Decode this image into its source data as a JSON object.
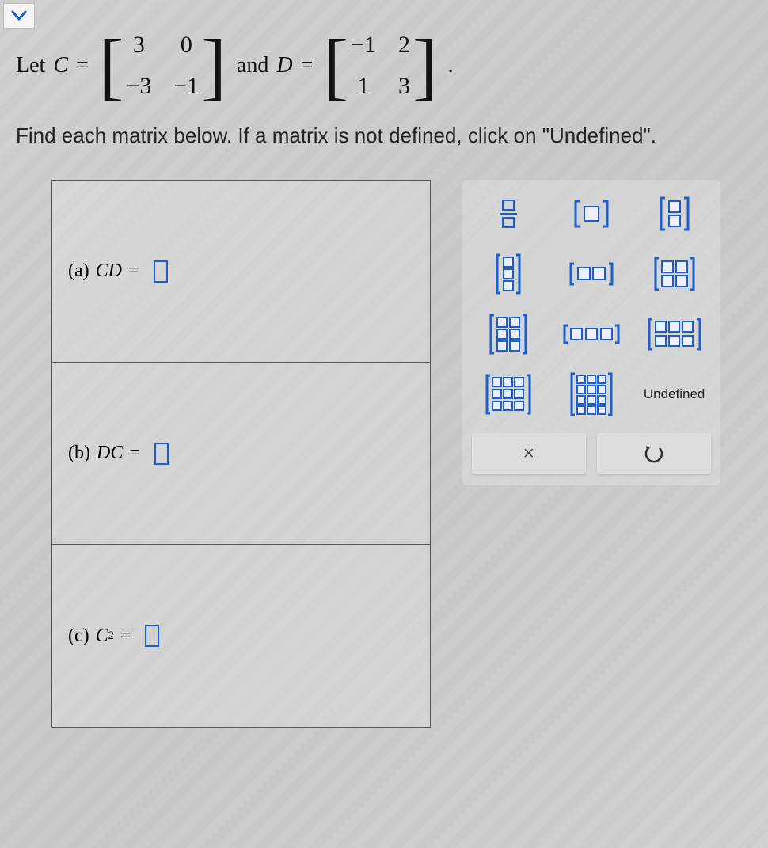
{
  "toggle_icon": "chevron-down",
  "problem": {
    "let_text": "Let",
    "var_C": "C",
    "equals": "=",
    "and_text": "and",
    "var_D": "D",
    "period": ".",
    "matrix_C": [
      [
        "3",
        "0"
      ],
      [
        "−3",
        "−1"
      ]
    ],
    "matrix_D": [
      [
        "−1",
        "2"
      ],
      [
        "1",
        "3"
      ]
    ],
    "instruction": "Find each matrix below. If a matrix is not defined, click on \"Undefined\"."
  },
  "parts": {
    "a": {
      "label": "(a)",
      "expr": "CD",
      "eq": "="
    },
    "b": {
      "label": "(b)",
      "expr": "DC",
      "eq": "="
    },
    "c": {
      "label": "(c)",
      "expr_base": "C",
      "expr_sup": "2",
      "eq": "="
    }
  },
  "palette": {
    "undefined_label": "Undefined",
    "clear_symbol": "×",
    "undo_symbol": "↺"
  }
}
